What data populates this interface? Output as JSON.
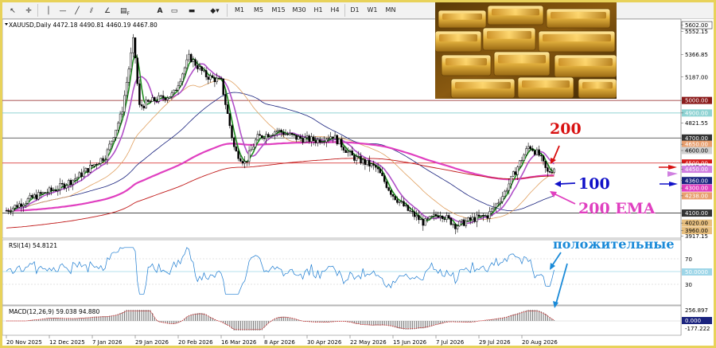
{
  "toolbar": {
    "timeframes": [
      "M1",
      "M5",
      "M15",
      "M30",
      "H1",
      "H4",
      "D1",
      "W1",
      "MN"
    ],
    "text_tool": "A",
    "fibo_label": "F"
  },
  "chart": {
    "header": "XAUUSD,Daily  4472.18 4490.81 4460.19 4467.80",
    "current_price": 4467.8
  },
  "price_axis": {
    "ylim": [
      3900,
      5650
    ],
    "levels": [
      {
        "label": "5602.00",
        "price": 5602,
        "color": "#ffffff",
        "bg": "#ffffff",
        "fg": "#000000",
        "boxed": true
      },
      {
        "label": "5552.15",
        "price": 5552,
        "fg": "#000000"
      },
      {
        "label": "5366.85",
        "price": 5367,
        "fg": "#000000"
      },
      {
        "label": "5187.00",
        "price": 5187,
        "fg": "#000000"
      },
      {
        "label": "5000.00",
        "price": 5000,
        "bg": "#8b1a1a",
        "fg": "#ffffff",
        "line": "#8b1a1a"
      },
      {
        "label": "4900.00",
        "price": 4900,
        "bg": "#8fd3d3",
        "fg": "#ffffff",
        "line": "#6fc6c6"
      },
      {
        "label": "4821.55",
        "price": 4821,
        "fg": "#000000"
      },
      {
        "label": "4700.00",
        "price": 4700,
        "bg": "#333333",
        "fg": "#ffffff",
        "line": "#333333"
      },
      {
        "label": "4650.00",
        "price": 4650,
        "bg": "#e8a070",
        "fg": "#ffffff"
      },
      {
        "label": "4600.00",
        "price": 4600,
        "bg": "#d0d0d0",
        "fg": "#000000"
      },
      {
        "label": "4500.00",
        "price": 4500,
        "bg": "#d41a1a",
        "fg": "#ffffff",
        "line": "#d41a1a"
      },
      {
        "label": "4467.80",
        "price": 4468,
        "bg": "#ffffff",
        "fg": "#000000"
      },
      {
        "label": "4450.00",
        "price": 4450,
        "bg": "#d080e0",
        "fg": "#ffffff"
      },
      {
        "label": "4360.00",
        "price": 4360,
        "bg": "#1a237e",
        "fg": "#ffffff"
      },
      {
        "label": "4300.00",
        "price": 4300,
        "bg": "#e040c0",
        "fg": "#ffffff"
      },
      {
        "label": "4238.00",
        "price": 4238,
        "bg": "#e8a070",
        "fg": "#ffffff"
      },
      {
        "label": "4100.00",
        "price": 4100,
        "bg": "#333333",
        "fg": "#ffffff",
        "line": "#333333"
      },
      {
        "label": "4020.00",
        "price": 4020,
        "bg": "#e8c080",
        "fg": "#000000"
      },
      {
        "label": "3960.00",
        "price": 3960,
        "bg": "#e8c080",
        "fg": "#000000"
      },
      {
        "label": "3917.15",
        "price": 3917,
        "fg": "#000000"
      }
    ]
  },
  "date_axis": [
    "20 Nov 2025",
    "12 Dec 2025",
    "7 Jan 2026",
    "29 Jan 2026",
    "20 Feb 2026",
    "16 Mar 2026",
    "8 Apr 2026",
    "30 Apr 2026",
    "22 May 2026",
    "15 Jun 2026",
    "7 Jul 2026",
    "29 Jul 2026",
    "20 Aug 2026"
  ],
  "rsi": {
    "header": "RSI(14) 54.8121",
    "levels": [
      "70",
      "50.0000",
      "30"
    ]
  },
  "macd": {
    "header": "MACD(12,26,9) 59.038 94.880",
    "levels": [
      "256.897",
      "0.000",
      "-177.222"
    ]
  },
  "annotations": {
    "label_200": "200",
    "label_100": "100",
    "label_200ema": "200 EMA",
    "label_positive": "положительные"
  },
  "colors": {
    "candles": "#000000",
    "ma_green": "#1f8c1f",
    "ma_violet": "#b050c8",
    "ma_orange": "#e0a060",
    "ma_navy": "#1a237e",
    "ema200": "#e040c0",
    "ma200": "#c01818",
    "annotation_red": "#d81010",
    "annotation_blue": "#1010c8",
    "annotation_magenta": "#e040c0",
    "annotation_sky": "#1a8ad8",
    "rsi_line": "#1a7ad0",
    "macd_hist": "#808080",
    "macd_signal": "#d01818"
  },
  "icons": [
    "cursor-icon",
    "crosshair-icon",
    "vertical-line-icon",
    "horizontal-line-icon",
    "trendline-icon",
    "channel-icon",
    "fibo-icon",
    "text-icon",
    "label-icon",
    "shapes-icon"
  ]
}
